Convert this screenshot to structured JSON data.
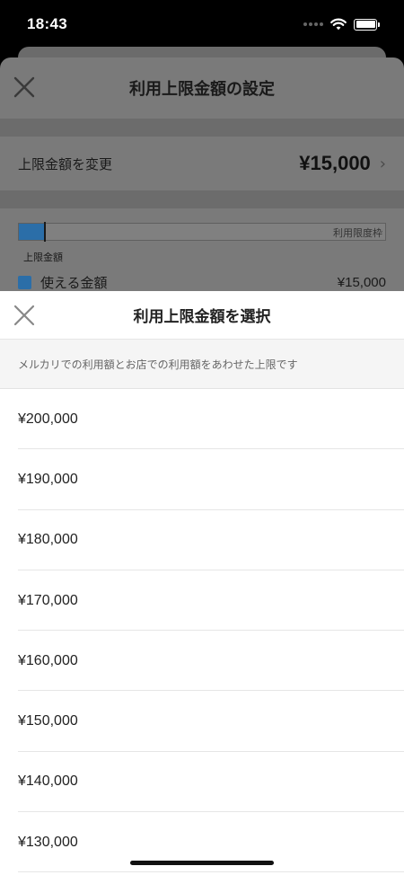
{
  "status_bar": {
    "time": "18:43"
  },
  "background_screen": {
    "title": "利用上限金額の設定",
    "change_limit": {
      "label": "上限金額を変更",
      "value": "¥15,000"
    },
    "usage_bar": {
      "label": "利用限度枠",
      "fill_fraction": 0.07
    },
    "limit_caption": "上限金額",
    "legend": {
      "label": "使える金額",
      "value": "¥15,000",
      "color": "#2b6ea8"
    }
  },
  "picker": {
    "title": "利用上限金額を選択",
    "note": "メルカリでの利用額とお店での利用額をあわせた上限です",
    "options": [
      "¥200,000",
      "¥190,000",
      "¥180,000",
      "¥170,000",
      "¥160,000",
      "¥150,000",
      "¥140,000",
      "¥130,000"
    ]
  }
}
